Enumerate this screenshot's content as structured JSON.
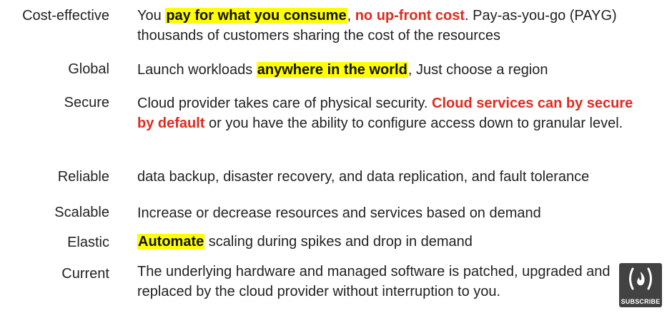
{
  "rows": [
    {
      "term": "Cost-effective",
      "segments": [
        {
          "text": "You ",
          "style": "plain"
        },
        {
          "text": "pay for what you consume",
          "style": "highlight"
        },
        {
          "text": ", ",
          "style": "plain"
        },
        {
          "text": "no up-front cost",
          "style": "red"
        },
        {
          "text": ". Pay-as-you-go (PAYG) thousands of customers sharing the cost of the resources",
          "style": "plain"
        }
      ]
    },
    {
      "term": "Global",
      "segments": [
        {
          "text": "Launch workloads ",
          "style": "plain"
        },
        {
          "text": "anywhere in the world",
          "style": "highlight"
        },
        {
          "text": ", Just choose a region",
          "style": "plain"
        }
      ]
    },
    {
      "term": "Secure",
      "segments": [
        {
          "text": "Cloud provider takes care of physical security. ",
          "style": "plain"
        },
        {
          "text": "Cloud services can by secure by default",
          "style": "red"
        },
        {
          "text": " or you have the ability to configure access down to granular level.",
          "style": "plain"
        }
      ]
    },
    {
      "term": "Reliable",
      "segments": [
        {
          "text": "data backup, disaster recovery, and data replication, and fault tolerance",
          "style": "plain"
        }
      ]
    },
    {
      "term": "Scalable",
      "segments": [
        {
          "text": "Increase or decrease resources and services based on demand",
          "style": "plain"
        }
      ]
    },
    {
      "term": "Elastic",
      "segments": [
        {
          "text": "Automate",
          "style": "highlight"
        },
        {
          "text": " scaling during spikes and drop in demand",
          "style": "plain"
        }
      ]
    },
    {
      "term": "Current",
      "segments": [
        {
          "text": "The underlying hardware and managed software is patched, upgraded and replaced by the cloud provider without interruption to you.",
          "style": "plain"
        }
      ]
    }
  ],
  "badge": {
    "label": "SUBSCRIBE",
    "icon": "freecodecamp-logo-icon"
  },
  "colors": {
    "highlight": "#ffff00",
    "emphasis": "#e02b1f",
    "text": "#222222"
  }
}
